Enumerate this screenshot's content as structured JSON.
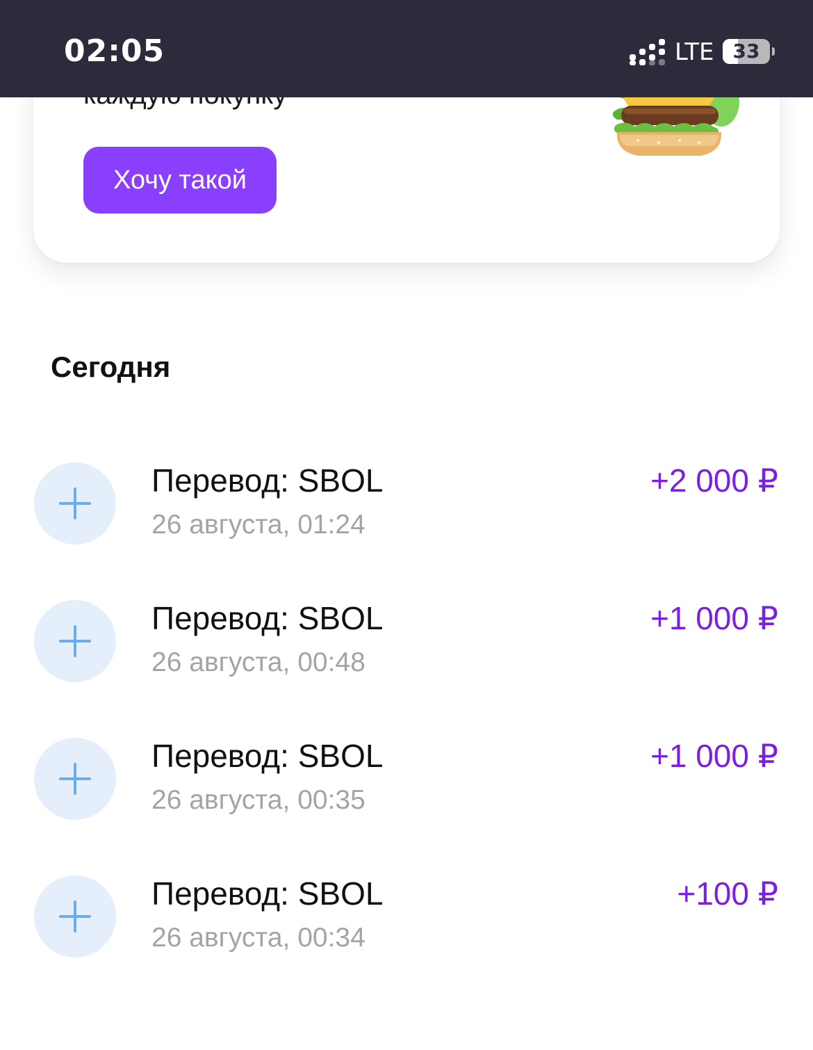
{
  "status_bar": {
    "time": "02:05",
    "network": "LTE",
    "battery": "33",
    "battery_level": 0.33,
    "icons": [
      "signal-icon",
      "battery-icon"
    ]
  },
  "promo": {
    "subtitle": "каждую покупку",
    "button_label": "Хочу такой",
    "image": "burger-image",
    "accent_color": "#8a3ffc"
  },
  "section": {
    "title": "Сегодня"
  },
  "transactions": [
    {
      "title": "Перевод: SBOL",
      "date": "26 августа, 01:24",
      "amount": "+2 000 ₽",
      "icon": "plus-icon"
    },
    {
      "title": "Перевод: SBOL",
      "date": "26 августа, 00:48",
      "amount": "+1 000 ₽",
      "icon": "plus-icon"
    },
    {
      "title": "Перевод: SBOL",
      "date": "26 августа, 00:35",
      "amount": "+1 000 ₽",
      "icon": "plus-icon"
    },
    {
      "title": "Перевод: SBOL",
      "date": "26 августа, 00:34",
      "amount": "+100 ₽",
      "icon": "plus-icon"
    }
  ],
  "colors": {
    "status_bar_bg": "#2c2a3b",
    "amount": "#7b1fe0",
    "icon_circle": "#e4effb",
    "plus": "#6aaee5",
    "date": "#a3a3a8"
  }
}
